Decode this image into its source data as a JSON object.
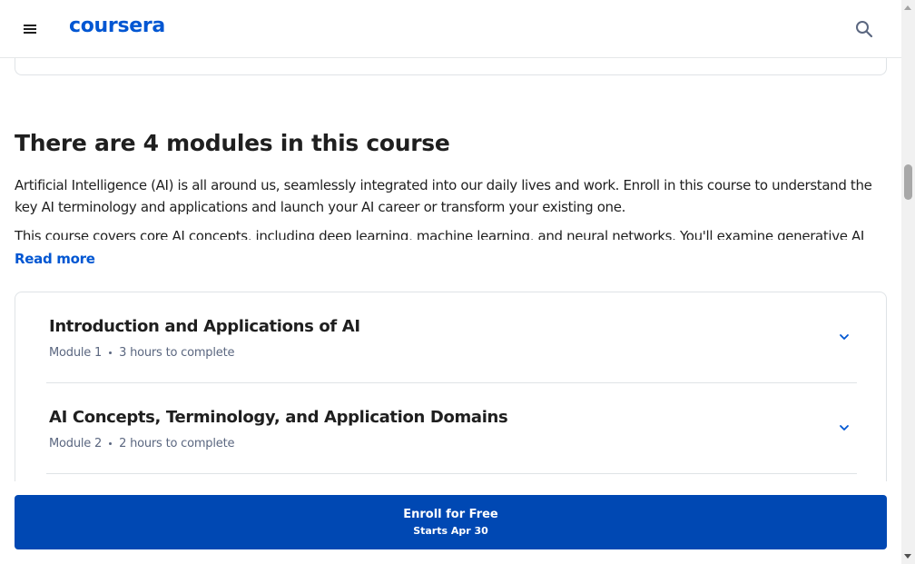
{
  "header": {
    "logo": "coursera",
    "menu_icon": "hamburger-menu-icon",
    "search_icon": "search-icon",
    "brand_color": "#0056d2"
  },
  "section": {
    "title": "There are 4 modules in this course",
    "paragraphs": [
      "Artificial Intelligence (AI) is all around us, seamlessly integrated into our daily lives and work. Enroll in this course to understand the key AI terminology and applications and launch your AI career or transform your existing one.",
      "This course covers core AI concepts, including deep learning, machine learning, and neural networks. You'll examine generative AI models"
    ],
    "read_more": "Read more"
  },
  "modules": [
    {
      "title": "Introduction and Applications of AI",
      "module_label": "Module 1",
      "duration": "3 hours to complete",
      "icon": "chevron-down-icon"
    },
    {
      "title": "AI Concepts, Terminology, and Application Domains",
      "module_label": "Module 2",
      "duration": "2 hours to complete",
      "icon": "chevron-down-icon"
    }
  ],
  "enroll": {
    "label": "Enroll for Free",
    "sub_label": "Starts Apr 30",
    "button_color": "#0048b3"
  }
}
